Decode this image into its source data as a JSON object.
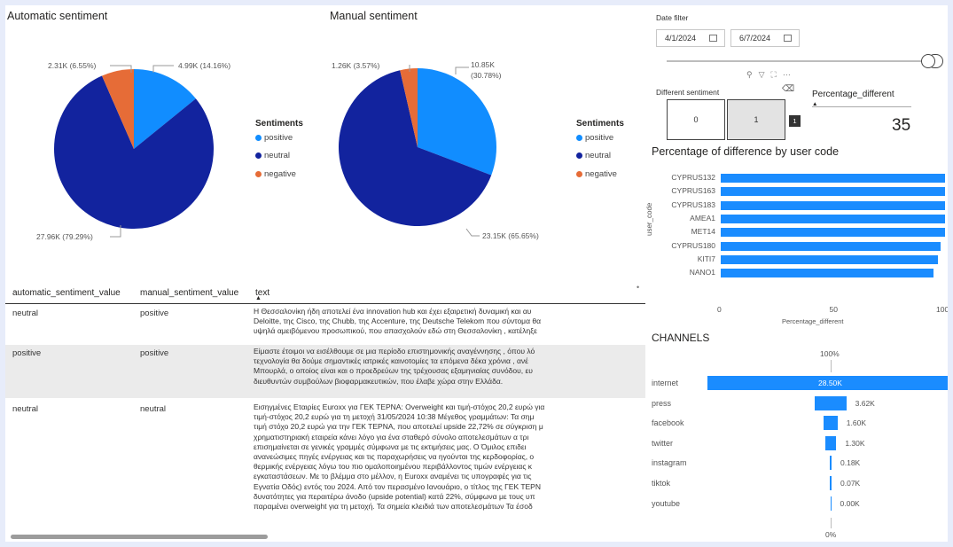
{
  "auto_chart": {
    "title": "Automatic sentiment",
    "legend_title": "Sentiments",
    "labels": {
      "positive": "4.99K (14.16%)",
      "neutral": "27.96K (79.29%)",
      "negative": "2.31K (6.55%)"
    }
  },
  "manual_chart": {
    "title": "Manual sentiment",
    "legend_title": "Sentiments",
    "labels": {
      "positive_a": "10.85K",
      "positive_b": "(30.78%)",
      "neutral": "23.15K (65.65%)",
      "negative": "1.26K (3.57%)"
    }
  },
  "legend": {
    "positive": "positive",
    "neutral": "neutral",
    "negative": "negative"
  },
  "chart_data": [
    {
      "type": "pie",
      "title": "Automatic sentiment",
      "categories": [
        "positive",
        "neutral",
        "negative"
      ],
      "values": [
        4.99,
        27.96,
        2.31
      ],
      "percentages": [
        14.16,
        79.29,
        6.55
      ],
      "colors": [
        "#118dff",
        "#12239e",
        "#e66c37"
      ],
      "legend": "right"
    },
    {
      "type": "pie",
      "title": "Manual sentiment",
      "categories": [
        "positive",
        "neutral",
        "negative"
      ],
      "values": [
        10.85,
        23.15,
        1.26
      ],
      "percentages": [
        30.78,
        65.65,
        3.57
      ],
      "colors": [
        "#118dff",
        "#12239e",
        "#e66c37"
      ],
      "legend": "right"
    },
    {
      "type": "bar",
      "title": "Percentage of difference by user code",
      "xlabel": "Percentage_different",
      "ylabel": "user_code",
      "categories": [
        "CYPRUS132",
        "CYPRUS163",
        "CYPRUS183",
        "AMEA1",
        "MET14",
        "CYPRUS180",
        "KITI7",
        "NANO1"
      ],
      "values": [
        100,
        100,
        100,
        100,
        100,
        98,
        97,
        95
      ],
      "xlim": [
        0,
        100
      ],
      "xticks": [
        "0",
        "50",
        "100"
      ],
      "color": "#118dff"
    },
    {
      "type": "bar",
      "title": "CHANNELS",
      "categories": [
        "internet",
        "press",
        "facebook",
        "twitter",
        "instagram",
        "tiktok",
        "youtube"
      ],
      "values": [
        28.5,
        3.62,
        1.6,
        1.3,
        0.18,
        0.07,
        0.0
      ],
      "value_labels": [
        "28.50K",
        "3.62K",
        "1.60K",
        "1.30K",
        "0.18K",
        "0.07K",
        "0.00K"
      ],
      "top_label": "100%",
      "bottom_label": "0%",
      "color": "#118dff"
    }
  ],
  "table": {
    "headers": [
      "automatic_sentiment_value",
      "manual_sentiment_value",
      "text"
    ],
    "rows": [
      {
        "auto": "neutral",
        "manual": "positive",
        "lines": [
          "Η Θεσσαλονίκη ήδη αποτελεί ένα innovation hub και έχει εξαιρετική δυναμική και αυ",
          "Deloitte, της Cisco, της Chubb, της Accenture, της Deutsche Telekom που σύντομα θα",
          "υψηλά αμειβόμενου προσωπικού, που απασχολούν εδώ στη Θεσσαλονίκη , κατέληξε"
        ]
      },
      {
        "auto": "positive",
        "manual": "positive",
        "lines": [
          "Είμαστε έτοιμοι να εισέλθουμε σε μια περίοδο επιστημονικής αναγέννησης , όπου λό",
          "τεχνολογία θα δούμε σημαντικές ιατρικές καινοτομίες τα επόμενα δέκα χρόνια , ανέ",
          "Μπουρλά, ο οποίος είναι και ο προεδρεύων της τρέχουσας εξαμηνιαίας συνόδου, ευ",
          "διευθυντών συμβούλων βιοφαρμακευτικών, που έλαβε χώρα στην Ελλάδα."
        ]
      },
      {
        "auto": "neutral",
        "manual": "neutral",
        "lines": [
          "Εισηγμένες Εταιρίες Euroxx για ΓΕΚ ΤΕΡΝΑ: Overweight και τιμή-στόχος 20,2 ευρώ για",
          "τιμή-στόχος 20,2 ευρώ για τη μετοχή 31/05/2024 10:38 Μέγεθος γραμμάτων: Τα σημ",
          "τιμή στόχο 20,2 ευρώ για την ΓΕΚ ΤΕΡΝΑ, που αποτελεί upside 22,72% σε σύγκριση μ",
          "χρηματιστηριακή εταιρεία κάνει λόγο για ένα σταθερό σύνολο αποτελεσμάτων α τρι",
          "επισημαίνεται σε γενικές γραμμές σύμφωνα με τις εκτιμήσεις μας. Ο Όμιλος επιδει",
          "ανανεώσιμες πηγές ενέργειας και τις παραχωρήσεις να ηγούνται της κερδοφορίας, ο",
          "θερμικής ενέργειας λόγω του πιο ομαλοποιημένου περιβάλλοντος τιμών ενέργειας κ",
          "εγκαταστάσεων. Με το βλέμμα στο μέλλον, η Euroxx αναμένει τις υπογραφές για τις",
          "Εγνατία Οδός) εντός του 2024. Από τον περασμένο Ιανουάριο, ο τίτλος της ΓΕΚ ΤΕΡΝ",
          "δυνατότητες για περαιτέρω άνοδο (upside potential) κατά 22%, σύμφωνα με τους υπ",
          "παραμένει overweight για τη μετοχή. Τα σημεία κλειδιά των αποτελεσμάτων Τα έσοδ"
        ]
      }
    ]
  },
  "date_filter": {
    "label": "Date filter",
    "start": "4/1/2024",
    "end": "6/7/2024"
  },
  "different_sentiment": {
    "label": "Different sentiment",
    "options": [
      "0",
      "1"
    ],
    "count": "1"
  },
  "percentage_card": {
    "label": "Percentage_different",
    "value": "35"
  },
  "bar_chart": {
    "title": "Percentage of difference by user code",
    "ylabel": "user_code",
    "xlabel": "Percentage_different",
    "ticks": [
      "0",
      "50",
      "100"
    ]
  },
  "channels": {
    "title": "CHANNELS",
    "top": "100%",
    "bottom": "0%"
  },
  "colors": {
    "positive": "#118dff",
    "neutral": "#12239e",
    "negative": "#e66c37",
    "bar": "#118dff",
    "accent": "#1a8cff"
  }
}
